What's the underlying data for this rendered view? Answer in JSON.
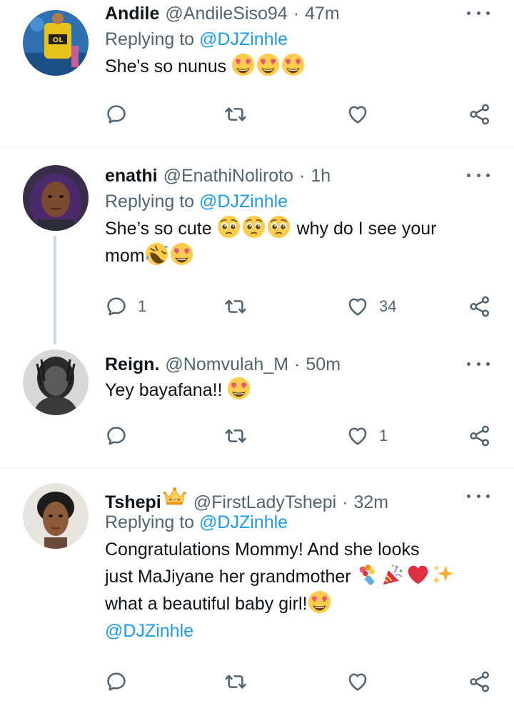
{
  "tweets": [
    {
      "name": "Andile",
      "handle": "@AndileSiso94",
      "separator": "·",
      "time": "47m",
      "replying_prefix": "Replying to",
      "replying_to": "@DJZinhle",
      "text": "She's so nunus",
      "emoji": [
        "heart-eyes",
        "heart-eyes",
        "heart-eyes"
      ],
      "reply_count": "",
      "like_count": ""
    },
    {
      "name": "enathi",
      "handle": "@EnathiNoliroto",
      "separator": "·",
      "time": "1h",
      "replying_prefix": "Replying to",
      "replying_to": "@DJZinhle",
      "text_line1": "She’s so cute",
      "text_line1_end": "why do I see your",
      "text_line2": "mom",
      "emoji": [
        "pleading",
        "pleading",
        "pleading",
        "rofl",
        "heart-eyes"
      ],
      "reply_count": "1",
      "like_count": "34"
    },
    {
      "name": "Reign.",
      "handle": "@Nomvulah_M",
      "separator": "·",
      "time": "50m",
      "text": "Yey bayafana!!",
      "emoji": [
        "heart-eyes"
      ],
      "reply_count": "",
      "like_count": "1"
    },
    {
      "name": "Tshepi",
      "name_emoji": "crown",
      "handle": "@FirstLadyTshepi",
      "separator": "·",
      "time": "32m",
      "replying_prefix": "Replying to",
      "replying_to": "@DJZinhle",
      "text_line1": "Congratulations Mommy! And she looks",
      "text_line2": "just MaJiyane her grandmother",
      "text_line3": "what a beautiful baby girl!",
      "text_line4": "@DJZinhle",
      "emoji": [
        "bouquet",
        "party-popper",
        "red-heart",
        "sparkles",
        "heart-eyes"
      ],
      "reply_count": "",
      "like_count": ""
    }
  ],
  "colors": {
    "text": "#0f1419",
    "secondary": "#536471",
    "link": "#1d9bf0",
    "divider": "#eff3f4",
    "thread_line": "#cfd9de"
  },
  "icons": [
    "reply-icon",
    "retweet-icon",
    "like-icon",
    "share-icon",
    "more-icon"
  ]
}
